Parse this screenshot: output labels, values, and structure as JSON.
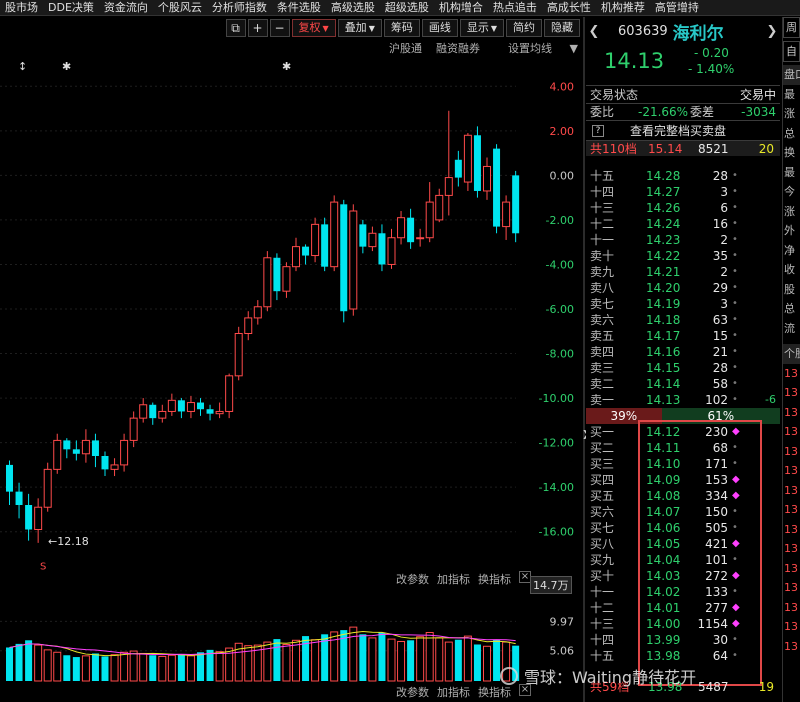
{
  "top_menu": [
    "股市场",
    "DDE决策",
    "资金流向",
    "个股风云",
    "分析师指数",
    "条件选股",
    "高级选股",
    "超级选股",
    "机构增合",
    "热点追击",
    "高成长性",
    "机构推荐",
    "高管增持"
  ],
  "toolbar": {
    "btn_fuquan": "复权",
    "btn_diejia": "叠加",
    "btn_choumai": "筹码",
    "btn_huaxian": "画线",
    "btn_xianshi": "显示",
    "btn_jianyue": "简约",
    "btn_hide": "隐藏"
  },
  "subtoolbar": {
    "hgt": "沪股通",
    "rzrq": "融资融券",
    "ma": "设置均线"
  },
  "chart": {
    "y_ticks": [
      "4.00",
      "2.00",
      "0.00",
      "-2.00",
      "-4.00",
      "-6.00",
      "-8.00",
      "-10.00",
      "-12.00",
      "-14.00",
      "-16.00"
    ],
    "low_annotation": "←12.18",
    "marker_s": "S",
    "vol_header": "14.7万",
    "vol_ticks": [
      "9.97",
      "5.06"
    ],
    "panel_ctrl": {
      "params": "改参数",
      "add": "加指标",
      "switch": "换指标"
    }
  },
  "chart_data": {
    "type": "candlestick",
    "y_axis_unit": "percent",
    "ylim": [
      -17,
      5
    ],
    "low_label": 12.18,
    "candles": [
      {
        "o": -13.0,
        "c": -14.2,
        "h": -12.8,
        "l": -14.8,
        "up": false
      },
      {
        "o": -14.2,
        "c": -14.8,
        "h": -13.8,
        "l": -15.4,
        "up": false
      },
      {
        "o": -14.8,
        "c": -15.9,
        "h": -14.3,
        "l": -16.4,
        "up": false
      },
      {
        "o": -15.9,
        "c": -14.9,
        "h": -14.5,
        "l": -16.5,
        "up": true
      },
      {
        "o": -14.9,
        "c": -13.2,
        "h": -12.9,
        "l": -15.1,
        "up": true
      },
      {
        "o": -13.2,
        "c": -11.9,
        "h": -11.6,
        "l": -13.4,
        "up": true
      },
      {
        "o": -11.9,
        "c": -12.3,
        "h": -11.8,
        "l": -12.7,
        "up": false
      },
      {
        "o": -12.3,
        "c": -12.5,
        "h": -11.9,
        "l": -12.8,
        "up": false
      },
      {
        "o": -12.5,
        "c": -11.9,
        "h": -11.4,
        "l": -12.9,
        "up": true
      },
      {
        "o": -11.9,
        "c": -12.6,
        "h": -11.6,
        "l": -13.1,
        "up": false
      },
      {
        "o": -12.6,
        "c": -13.2,
        "h": -12.4,
        "l": -13.5,
        "up": false
      },
      {
        "o": -13.2,
        "c": -13.0,
        "h": -12.7,
        "l": -13.5,
        "up": true
      },
      {
        "o": -13.0,
        "c": -11.9,
        "h": -11.6,
        "l": -13.3,
        "up": true
      },
      {
        "o": -11.9,
        "c": -10.9,
        "h": -10.6,
        "l": -12.2,
        "up": true
      },
      {
        "o": -10.9,
        "c": -10.3,
        "h": -10.0,
        "l": -11.1,
        "up": true
      },
      {
        "o": -10.3,
        "c": -10.9,
        "h": -10.2,
        "l": -11.2,
        "up": false
      },
      {
        "o": -10.9,
        "c": -10.6,
        "h": -10.3,
        "l": -11.1,
        "up": true
      },
      {
        "o": -10.6,
        "c": -10.1,
        "h": -9.8,
        "l": -10.8,
        "up": true
      },
      {
        "o": -10.1,
        "c": -10.6,
        "h": -10.0,
        "l": -10.9,
        "up": false
      },
      {
        "o": -10.6,
        "c": -10.2,
        "h": -9.9,
        "l": -10.9,
        "up": true
      },
      {
        "o": -10.2,
        "c": -10.5,
        "h": -10.0,
        "l": -10.8,
        "up": false
      },
      {
        "o": -10.5,
        "c": -10.7,
        "h": -10.3,
        "l": -11.0,
        "up": false
      },
      {
        "o": -10.7,
        "c": -10.6,
        "h": -10.2,
        "l": -10.9,
        "up": true
      },
      {
        "o": -10.6,
        "c": -9.0,
        "h": -8.9,
        "l": -10.9,
        "up": true
      },
      {
        "o": -9.0,
        "c": -7.1,
        "h": -6.8,
        "l": -9.2,
        "up": true
      },
      {
        "o": -7.1,
        "c": -6.4,
        "h": -6.1,
        "l": -7.4,
        "up": true
      },
      {
        "o": -6.4,
        "c": -5.9,
        "h": -5.6,
        "l": -6.7,
        "up": true
      },
      {
        "o": -5.9,
        "c": -3.7,
        "h": -3.4,
        "l": -6.1,
        "up": true
      },
      {
        "o": -3.7,
        "c": -5.2,
        "h": -3.5,
        "l": -5.6,
        "up": false
      },
      {
        "o": -5.2,
        "c": -4.1,
        "h": -3.9,
        "l": -5.5,
        "up": true
      },
      {
        "o": -4.1,
        "c": -3.2,
        "h": -2.8,
        "l": -4.3,
        "up": true
      },
      {
        "o": -3.2,
        "c": -3.6,
        "h": -3.1,
        "l": -4.0,
        "up": false
      },
      {
        "o": -3.6,
        "c": -2.2,
        "h": -1.9,
        "l": -3.9,
        "up": true
      },
      {
        "o": -2.2,
        "c": -4.1,
        "h": -1.9,
        "l": -4.3,
        "up": false
      },
      {
        "o": -4.1,
        "c": -1.2,
        "h": -0.9,
        "l": -4.3,
        "up": true
      },
      {
        "o": -1.3,
        "c": -6.1,
        "h": -1.1,
        "l": -6.6,
        "up": false
      },
      {
        "o": -6.0,
        "c": -1.6,
        "h": -1.3,
        "l": -6.3,
        "up": true
      },
      {
        "o": -2.2,
        "c": -3.2,
        "h": -2.0,
        "l": -3.5,
        "up": false
      },
      {
        "o": -3.2,
        "c": -2.6,
        "h": -2.3,
        "l": -3.4,
        "up": true
      },
      {
        "o": -2.6,
        "c": -4.0,
        "h": -2.2,
        "l": -4.3,
        "up": false
      },
      {
        "o": -4.0,
        "c": -2.8,
        "h": -2.4,
        "l": -4.2,
        "up": true
      },
      {
        "o": -2.8,
        "c": -1.9,
        "h": -1.6,
        "l": -3.1,
        "up": true
      },
      {
        "o": -1.9,
        "c": -3.0,
        "h": -1.5,
        "l": -3.3,
        "up": false
      },
      {
        "o": -2.8,
        "c": -2.8,
        "h": -2.4,
        "l": -3.2,
        "up": true
      },
      {
        "o": -2.8,
        "c": -1.2,
        "h": -0.3,
        "l": -3.0,
        "up": true
      },
      {
        "o": -2.0,
        "c": -0.9,
        "h": -0.6,
        "l": -2.1,
        "up": true
      },
      {
        "o": -0.9,
        "c": -0.1,
        "h": 2.9,
        "l": -1.8,
        "up": true
      },
      {
        "o": 0.7,
        "c": -0.1,
        "h": 1.1,
        "l": -0.5,
        "up": false
      },
      {
        "o": -0.3,
        "c": 1.8,
        "h": 1.9,
        "l": -0.7,
        "up": true
      },
      {
        "o": 1.8,
        "c": -0.7,
        "h": 2.2,
        "l": -1.0,
        "up": false
      },
      {
        "o": -0.7,
        "c": 0.4,
        "h": 0.8,
        "l": -1.1,
        "up": true
      },
      {
        "o": 1.2,
        "c": -2.3,
        "h": 1.4,
        "l": -2.6,
        "up": false
      },
      {
        "o": -2.3,
        "c": -1.2,
        "h": -0.9,
        "l": -2.9,
        "up": true
      },
      {
        "o": 0.0,
        "c": -2.6,
        "h": 0.2,
        "l": -3.0,
        "up": false
      }
    ],
    "volumes": [
      5.6,
      6.2,
      6.8,
      6.0,
      5.2,
      4.8,
      4.3,
      4.0,
      4.2,
      4.6,
      4.1,
      4.4,
      4.8,
      5.0,
      4.6,
      4.3,
      4.1,
      4.3,
      4.5,
      4.2,
      4.8,
      5.2,
      4.9,
      5.5,
      6.3,
      5.9,
      6.0,
      6.5,
      7.0,
      6.1,
      6.8,
      7.5,
      6.9,
      7.8,
      8.2,
      8.5,
      9.0,
      7.8,
      7.2,
      8.1,
      7.0,
      6.6,
      6.8,
      7.4,
      8.1,
      7.2,
      6.5,
      6.9,
      7.5,
      6.1,
      5.8,
      6.9,
      6.5,
      5.9
    ]
  },
  "quote": {
    "code": "603639",
    "name": "海利尔",
    "price": "14.13",
    "change": "- 0.20",
    "change_pct": "- 1.40%",
    "status_label": "交易状态",
    "status_value": "交易中",
    "ratio_label": "委比",
    "ratio_value": "-21.66%",
    "diff_label": "委差",
    "diff_value": "-3034",
    "full_book": "查看完整档买卖盘",
    "sell_total_label": "共110档",
    "sell_total_price": "15.14",
    "sell_total_vol": "8521",
    "sell_total_count": "20",
    "sell": [
      {
        "level": "十五",
        "price": "14.28",
        "vol": "28"
      },
      {
        "level": "十四",
        "price": "14.27",
        "vol": "3"
      },
      {
        "level": "十三",
        "price": "14.26",
        "vol": "6"
      },
      {
        "level": "十二",
        "price": "14.24",
        "vol": "16"
      },
      {
        "level": "十一",
        "price": "14.23",
        "vol": "2"
      },
      {
        "level": "卖十",
        "price": "14.22",
        "vol": "35"
      },
      {
        "level": "卖九",
        "price": "14.21",
        "vol": "2"
      },
      {
        "level": "卖八",
        "price": "14.20",
        "vol": "29"
      },
      {
        "level": "卖七",
        "price": "14.19",
        "vol": "3"
      },
      {
        "level": "卖六",
        "price": "14.18",
        "vol": "63"
      },
      {
        "level": "卖五",
        "price": "14.17",
        "vol": "15"
      },
      {
        "level": "卖四",
        "price": "14.16",
        "vol": "21"
      },
      {
        "level": "卖三",
        "price": "14.15",
        "vol": "28"
      },
      {
        "level": "卖二",
        "price": "14.14",
        "vol": "58"
      },
      {
        "level": "卖一",
        "price": "14.13",
        "vol": "102",
        "chg": "-6"
      }
    ],
    "ratio_buy": "39%",
    "ratio_sell": "61%",
    "ratio_buy_fraction": 0.39,
    "buy": [
      {
        "level": "买一",
        "price": "14.12",
        "vol": "230",
        "pink": true
      },
      {
        "level": "买二",
        "price": "14.11",
        "vol": "68",
        "pink": false
      },
      {
        "level": "买三",
        "price": "14.10",
        "vol": "171",
        "pink": false
      },
      {
        "level": "买四",
        "price": "14.09",
        "vol": "153",
        "pink": true
      },
      {
        "level": "买五",
        "price": "14.08",
        "vol": "334",
        "pink": true
      },
      {
        "level": "买六",
        "price": "14.07",
        "vol": "150",
        "pink": false
      },
      {
        "level": "买七",
        "price": "14.06",
        "vol": "505",
        "pink": false
      },
      {
        "level": "买八",
        "price": "14.05",
        "vol": "421",
        "pink": true
      },
      {
        "level": "买九",
        "price": "14.04",
        "vol": "101",
        "pink": false
      },
      {
        "level": "买十",
        "price": "14.03",
        "vol": "272",
        "pink": true
      },
      {
        "level": "十一",
        "price": "14.02",
        "vol": "133",
        "pink": false
      },
      {
        "level": "十二",
        "price": "14.01",
        "vol": "277",
        "pink": true
      },
      {
        "level": "十三",
        "price": "14.00",
        "vol": "1154",
        "pink": true
      },
      {
        "level": "十四",
        "price": "13.99",
        "vol": "30",
        "pink": false
      },
      {
        "level": "十五",
        "price": "13.98",
        "vol": "64",
        "pink": false
      }
    ],
    "buy_total_label": "共59档",
    "buy_total_price": "13.98",
    "buy_total_vol": "5487",
    "buy_total_count": "19"
  },
  "right_strip": {
    "tab": "盘口",
    "btn1": "周",
    "btn2": "自",
    "items": [
      "最",
      "涨",
      "总",
      "换",
      "最",
      "今",
      "涨",
      "外",
      "净",
      "收",
      "股",
      "总",
      "流"
    ],
    "section": "个股",
    "reds": [
      "13",
      "13",
      "13",
      "13",
      "13",
      "13",
      "13",
      "13",
      "13",
      "13",
      "13",
      "13",
      "13",
      "13",
      "13"
    ]
  },
  "watermark": "雪球：Waiting静待花开"
}
